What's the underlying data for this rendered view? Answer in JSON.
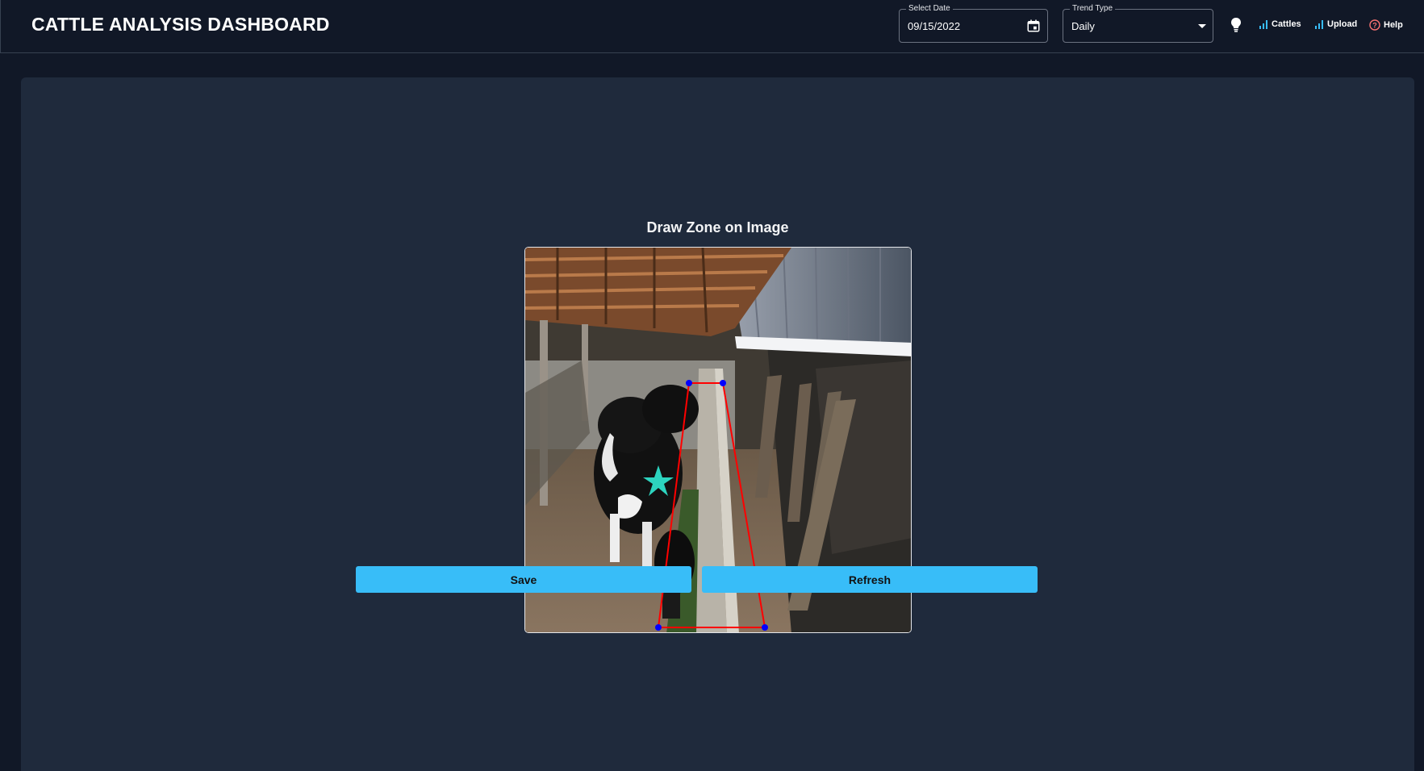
{
  "header": {
    "title": "CATTLE ANALYSIS DASHBOARD",
    "date_field": {
      "label": "Select Date",
      "value": "09/15/2022",
      "icon": "calendar-icon"
    },
    "trend_field": {
      "label": "Trend Type",
      "value": "Daily",
      "icon": "chevron-down-icon"
    },
    "theme_icon": "lightbulb-icon",
    "nav": [
      {
        "label": "Cattles",
        "icon": "bar-chart-icon"
      },
      {
        "label": "Upload",
        "icon": "bar-chart-icon"
      },
      {
        "label": "Help",
        "icon": "help-circle-icon"
      }
    ]
  },
  "main": {
    "title": "Draw Zone on Image",
    "image_description": "Cattle shed with black and white cows feeding, red polygon zone drawn",
    "buttons": {
      "save": "Save",
      "refresh": "Refresh"
    }
  },
  "colors": {
    "background": "#111827",
    "panel": "#1f2a3c",
    "button": "#38bdf8",
    "zone_line": "#ff0000",
    "zone_vertex": "#0000ff",
    "help_icon": "#f87171",
    "nav_icon": "#38bdf8"
  }
}
